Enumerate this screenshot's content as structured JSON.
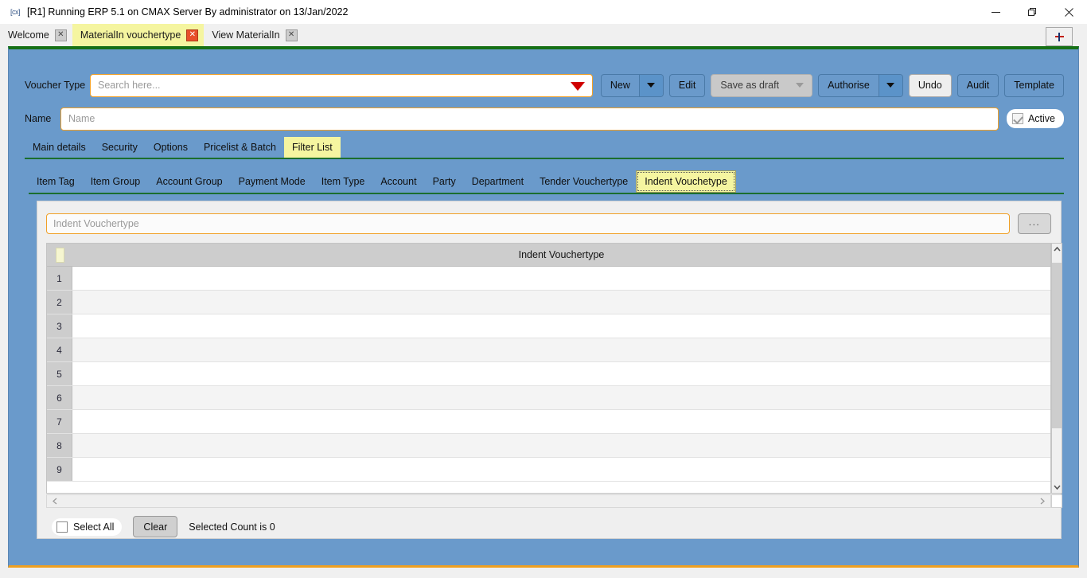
{
  "window": {
    "title": "[R1] Running ERP 5.1 on CMAX Server By administrator on 13/Jan/2022",
    "app_glyph": "[cx]",
    "minimize_label": "Minimize",
    "restore_label": "Restore",
    "close_label": "Close"
  },
  "tabstrip": {
    "tabs": [
      {
        "label": "Welcome",
        "close": "✕",
        "active": false
      },
      {
        "label": "MaterialIn vouchertype",
        "close": "✕",
        "active": true
      },
      {
        "label": "View MaterialIn",
        "close": "✕",
        "active": false
      }
    ],
    "new_tab_label": "+"
  },
  "form": {
    "voucher_type_label": "Voucher Type",
    "voucher_type_value": "",
    "voucher_type_placeholder": "Search here...",
    "name_label": "Name",
    "name_value": "",
    "name_placeholder": "Name",
    "active_label": "Active",
    "active_checked": true
  },
  "toolbar": {
    "buttons": [
      {
        "label": "New",
        "dropdown": true,
        "disabled": false,
        "style": "blue"
      },
      {
        "label": "Edit",
        "dropdown": false,
        "disabled": false,
        "style": "blue"
      },
      {
        "label": "Save as draft",
        "dropdown": true,
        "disabled": true,
        "style": "disabled"
      },
      {
        "label": "Authorise",
        "dropdown": true,
        "disabled": false,
        "style": "blue"
      },
      {
        "label": "Undo",
        "dropdown": false,
        "disabled": false,
        "style": "light"
      },
      {
        "label": "Audit",
        "dropdown": false,
        "disabled": false,
        "style": "blue"
      },
      {
        "label": "Template",
        "dropdown": false,
        "disabled": false,
        "style": "blue"
      }
    ]
  },
  "tabs_primary": {
    "items": [
      {
        "label": "Main details",
        "selected": false
      },
      {
        "label": "Security",
        "selected": false
      },
      {
        "label": "Options",
        "selected": false
      },
      {
        "label": "Pricelist & Batch",
        "selected": false
      },
      {
        "label": "Filter List",
        "selected": true
      }
    ]
  },
  "tabs_secondary": {
    "items": [
      {
        "label": "Item Tag",
        "selected": false
      },
      {
        "label": "Item Group",
        "selected": false
      },
      {
        "label": "Account Group",
        "selected": false
      },
      {
        "label": "Payment Mode",
        "selected": false
      },
      {
        "label": "Item Type",
        "selected": false
      },
      {
        "label": "Account",
        "selected": false
      },
      {
        "label": "Party",
        "selected": false
      },
      {
        "label": "Department",
        "selected": false
      },
      {
        "label": "Tender Vouchertype",
        "selected": false
      },
      {
        "label": "Indent Vouchetype",
        "selected": true
      }
    ]
  },
  "filter_panel": {
    "search_value": "",
    "search_placeholder": "Indent Vouchertype",
    "browse_label": "...",
    "grid": {
      "column_header": "Indent Vouchertype",
      "rows": [
        {
          "num": "1",
          "value": ""
        },
        {
          "num": "2",
          "value": ""
        },
        {
          "num": "3",
          "value": ""
        },
        {
          "num": "4",
          "value": ""
        },
        {
          "num": "5",
          "value": ""
        },
        {
          "num": "6",
          "value": ""
        },
        {
          "num": "7",
          "value": ""
        },
        {
          "num": "8",
          "value": ""
        },
        {
          "num": "9",
          "value": ""
        }
      ]
    },
    "footer": {
      "select_all_label": "Select All",
      "select_all_checked": false,
      "clear_label": "Clear",
      "selected_count_text": "Selected Count is 0"
    }
  },
  "colors": {
    "panel_blue": "#6a9acb",
    "accent_green": "#167016",
    "accent_orange": "#f0a020",
    "tab_highlight": "#f5f5a0",
    "field_border": "#f0a028",
    "red_caret": "#d00000",
    "close_red": "#e8502a"
  }
}
